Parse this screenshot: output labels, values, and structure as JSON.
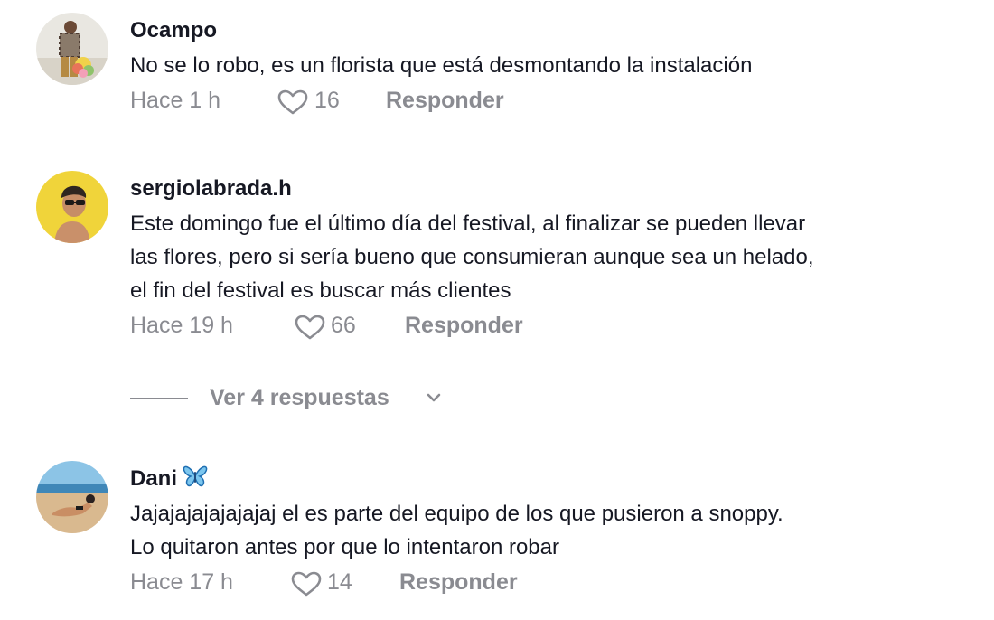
{
  "comments": [
    {
      "username": "Ocampo",
      "text_lines": [
        "No se lo robo, es un florista que está desmontando la instalación"
      ],
      "time": "Hace 1 h",
      "likes": "16",
      "reply_label": "Responder",
      "avatar_icon": "person-with-flowers-avatar"
    },
    {
      "username": "sergiolabrada.h",
      "text_lines": [
        "Este domingo fue el último día del festival, al finalizar se pueden llevar",
        "las flores, pero si sería bueno que consumieran aunque sea un helado,",
        "el fin del festival es buscar más clientes"
      ],
      "time": "Hace 19 h",
      "likes": "66",
      "reply_label": "Responder",
      "avatar_icon": "person-yellow-background-avatar"
    },
    {
      "username": "Dani",
      "username_badge_icon": "blue-butterfly-emoji",
      "text_lines": [
        "Jajajajajajajajaj el es parte del equipo de los que pusieron a snoppy.",
        "Lo quitaron antes por que lo intentaron robar"
      ],
      "time": "Hace 17 h",
      "likes": "14",
      "reply_label": "Responder",
      "avatar_icon": "beach-photo-avatar"
    }
  ],
  "view_replies": {
    "label": "Ver 4 respuestas",
    "icon": "chevron-down-icon"
  },
  "colors": {
    "text": "#161823",
    "muted": "#8a8b91",
    "background": "#ffffff"
  }
}
